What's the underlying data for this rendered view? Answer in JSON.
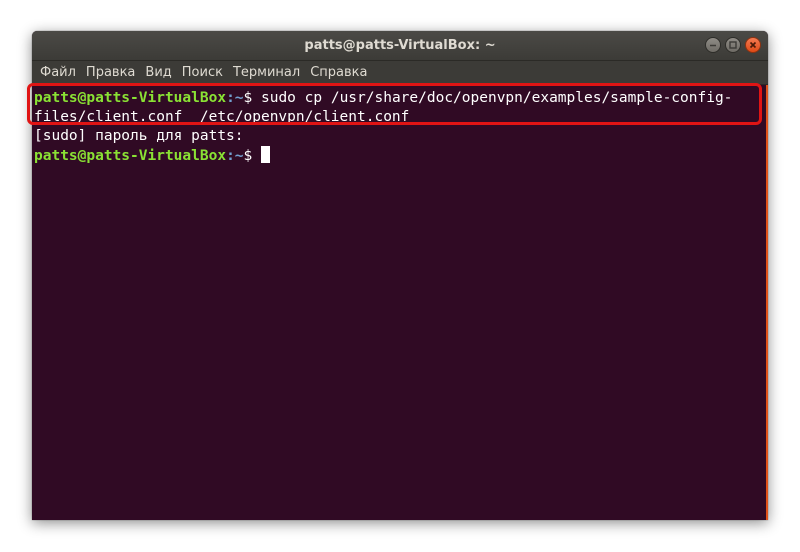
{
  "window": {
    "title": "patts@patts-VirtualBox: ~"
  },
  "menu": [
    {
      "label": "Файл"
    },
    {
      "label": "Правка"
    },
    {
      "label": "Вид"
    },
    {
      "label": "Поиск"
    },
    {
      "label": "Терминал"
    },
    {
      "label": "Справка"
    }
  ],
  "terminal": {
    "prompt_user": "patts@patts-VirtualBox",
    "prompt_path": ":~",
    "prompt_symbol": "$",
    "command_line_1": " sudo cp /usr/share/doc/openvpn/examples/sample-config-",
    "command_line_2": "files/client.conf  /etc/openvpn/client.conf",
    "sudo_prompt": "[sudo] пароль для patts:",
    "current_input": " "
  },
  "colors": {
    "terminal_bg": "#300a24",
    "prompt_user": "#8ae234",
    "prompt_path": "#729fcf",
    "highlight": "#e01414"
  }
}
